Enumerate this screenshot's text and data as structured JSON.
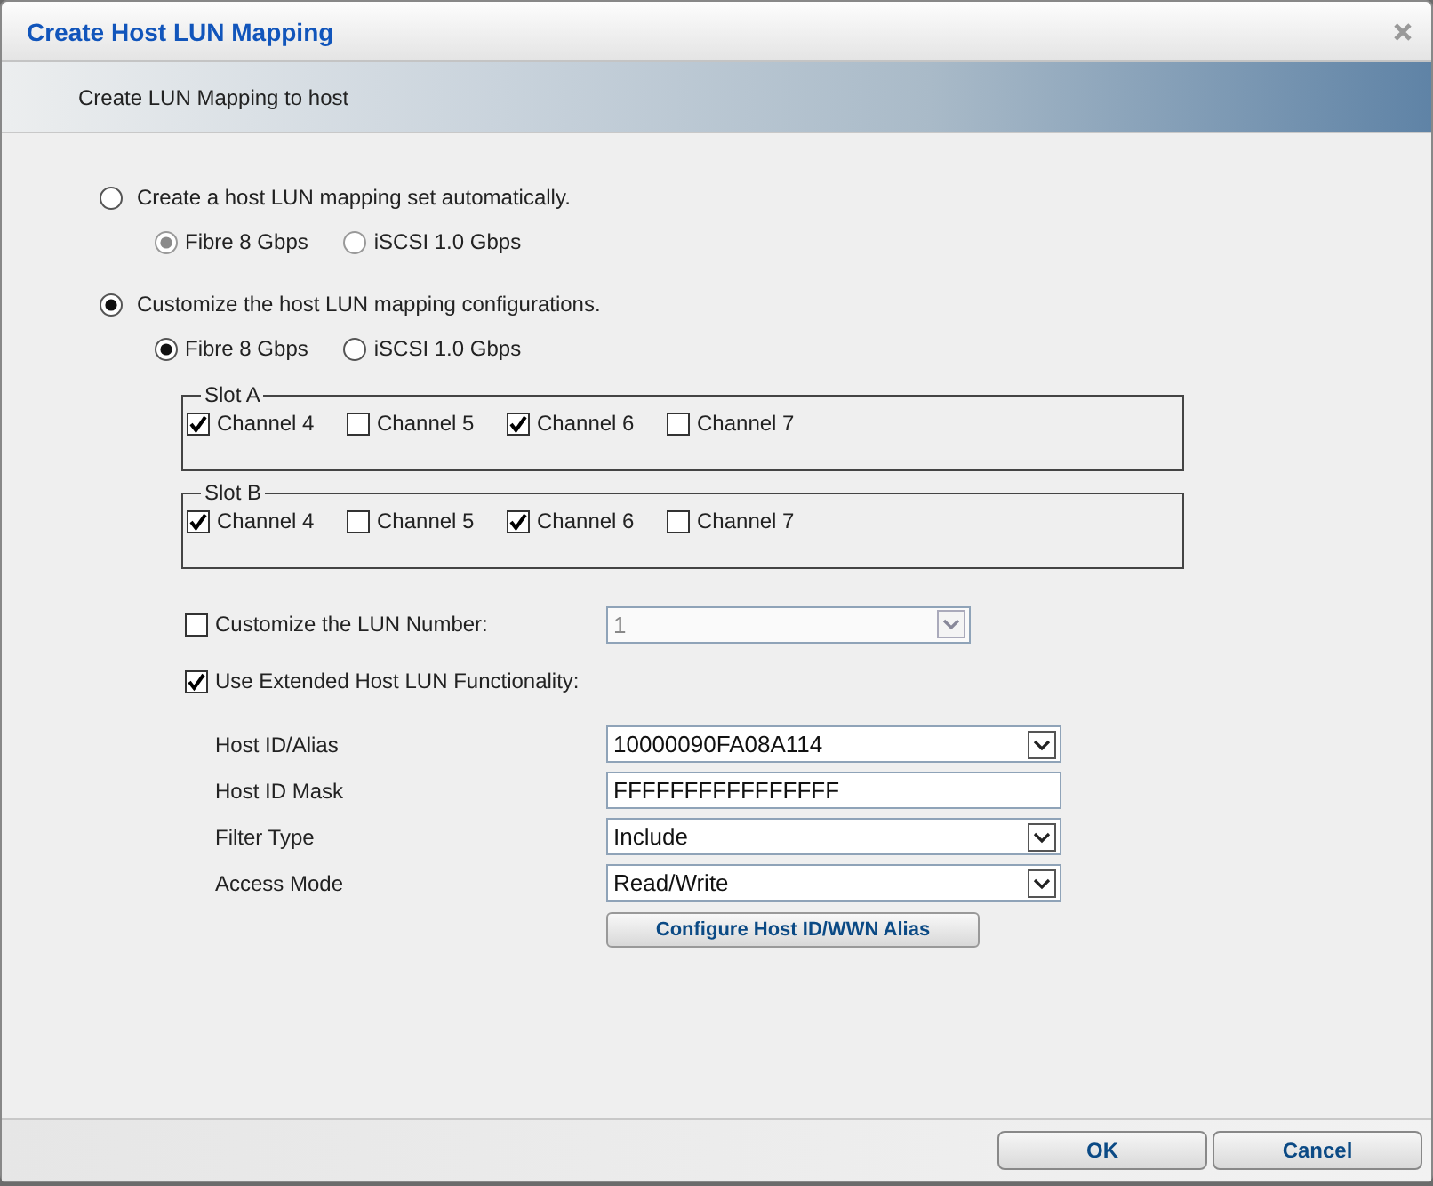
{
  "dialog": {
    "title": "Create Host LUN Mapping",
    "subtitle": "Create LUN Mapping to host"
  },
  "modes": [
    {
      "label": "Create a host LUN mapping set automatically.",
      "selected": false,
      "speeds": [
        {
          "label": "Fibre 8 Gbps",
          "selected": true,
          "disabled": true
        },
        {
          "label": "iSCSI 1.0 Gbps",
          "selected": false,
          "disabled": true
        }
      ]
    },
    {
      "label": "Customize the host LUN mapping configurations.",
      "selected": true,
      "speeds": [
        {
          "label": "Fibre 8 Gbps",
          "selected": true,
          "disabled": false
        },
        {
          "label": "iSCSI 1.0 Gbps",
          "selected": false,
          "disabled": false
        }
      ]
    }
  ],
  "slots": [
    {
      "legend": "Slot A",
      "channels": [
        {
          "label": "Channel 4",
          "checked": true
        },
        {
          "label": "Channel 5",
          "checked": false
        },
        {
          "label": "Channel 6",
          "checked": true
        },
        {
          "label": "Channel 7",
          "checked": false
        }
      ]
    },
    {
      "legend": "Slot B",
      "channels": [
        {
          "label": "Channel 4",
          "checked": true
        },
        {
          "label": "Channel 5",
          "checked": false
        },
        {
          "label": "Channel 6",
          "checked": true
        },
        {
          "label": "Channel 7",
          "checked": false
        }
      ]
    }
  ],
  "lun_number": {
    "label": "Customize the LUN Number:",
    "checked": false,
    "value": "1",
    "disabled": true
  },
  "extended": {
    "label": "Use Extended Host LUN Functionality:",
    "checked": true
  },
  "fields": [
    {
      "label": "Host ID/Alias",
      "kind": "select",
      "value": "10000090FA08A114"
    },
    {
      "label": "Host ID Mask",
      "kind": "text",
      "value": "FFFFFFFFFFFFFFFF"
    },
    {
      "label": "Filter Type",
      "kind": "select",
      "value": "Include"
    },
    {
      "label": "Access Mode",
      "kind": "select",
      "value": "Read/Write"
    }
  ],
  "configure_button": "Configure Host ID/WWN Alias",
  "buttons": [
    "OK",
    "Cancel"
  ]
}
